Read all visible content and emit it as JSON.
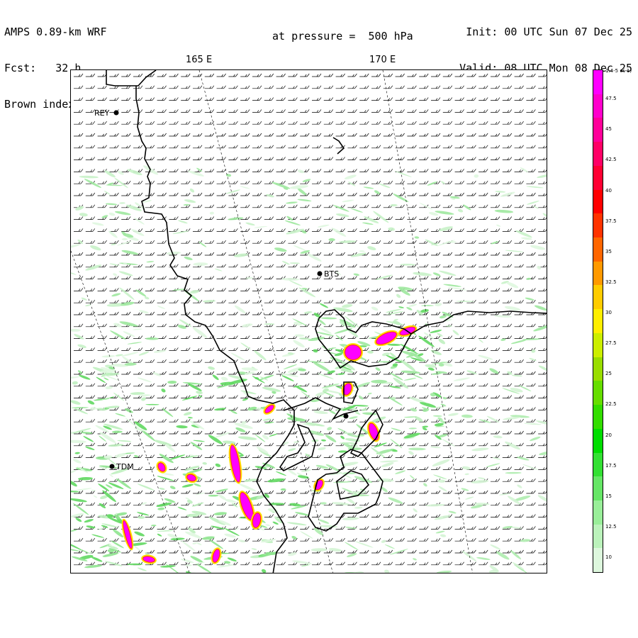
{
  "header": {
    "model": "AMPS 0.89-km WRF",
    "forecast": "Fcst:   32 h",
    "field": "Brown index",
    "init": "Init: 00 UTC Sun 07 Dec 25",
    "valid": "Valid: 08 UTC Mon 08 Dec 25",
    "pressure": "at pressure =  500 hPa"
  },
  "longitude_labels": [
    "165 E",
    "170 E"
  ],
  "stations": [
    {
      "id": "rey",
      "label": "REY"
    },
    {
      "id": "bts",
      "label": "BTS"
    },
    {
      "id": "tdm",
      "label": "TDM"
    },
    {
      "id": "unnamed",
      "label": ""
    }
  ],
  "colorbar": {
    "labels": [
      "1.4-5 e(-1)",
      "47.5",
      "45",
      "42.5",
      "40",
      "37.5",
      "35",
      "32.5",
      "30",
      "27.5",
      "25",
      "22.5",
      "20",
      "17.5",
      "15",
      "12.5",
      "10"
    ],
    "colors": [
      "#ff00ff",
      "#ff00cc",
      "#ff0099",
      "#ff0066",
      "#ff0033",
      "#ff0000",
      "#ff3300",
      "#ff6600",
      "#ff9900",
      "#ffcc00",
      "#ffee00",
      "#ccee00",
      "#99dd00",
      "#66dd00",
      "#33dd00",
      "#00dd00",
      "#33e033",
      "#66e666",
      "#99ee99",
      "#bbf2bb",
      "#ddf7dd"
    ]
  }
}
